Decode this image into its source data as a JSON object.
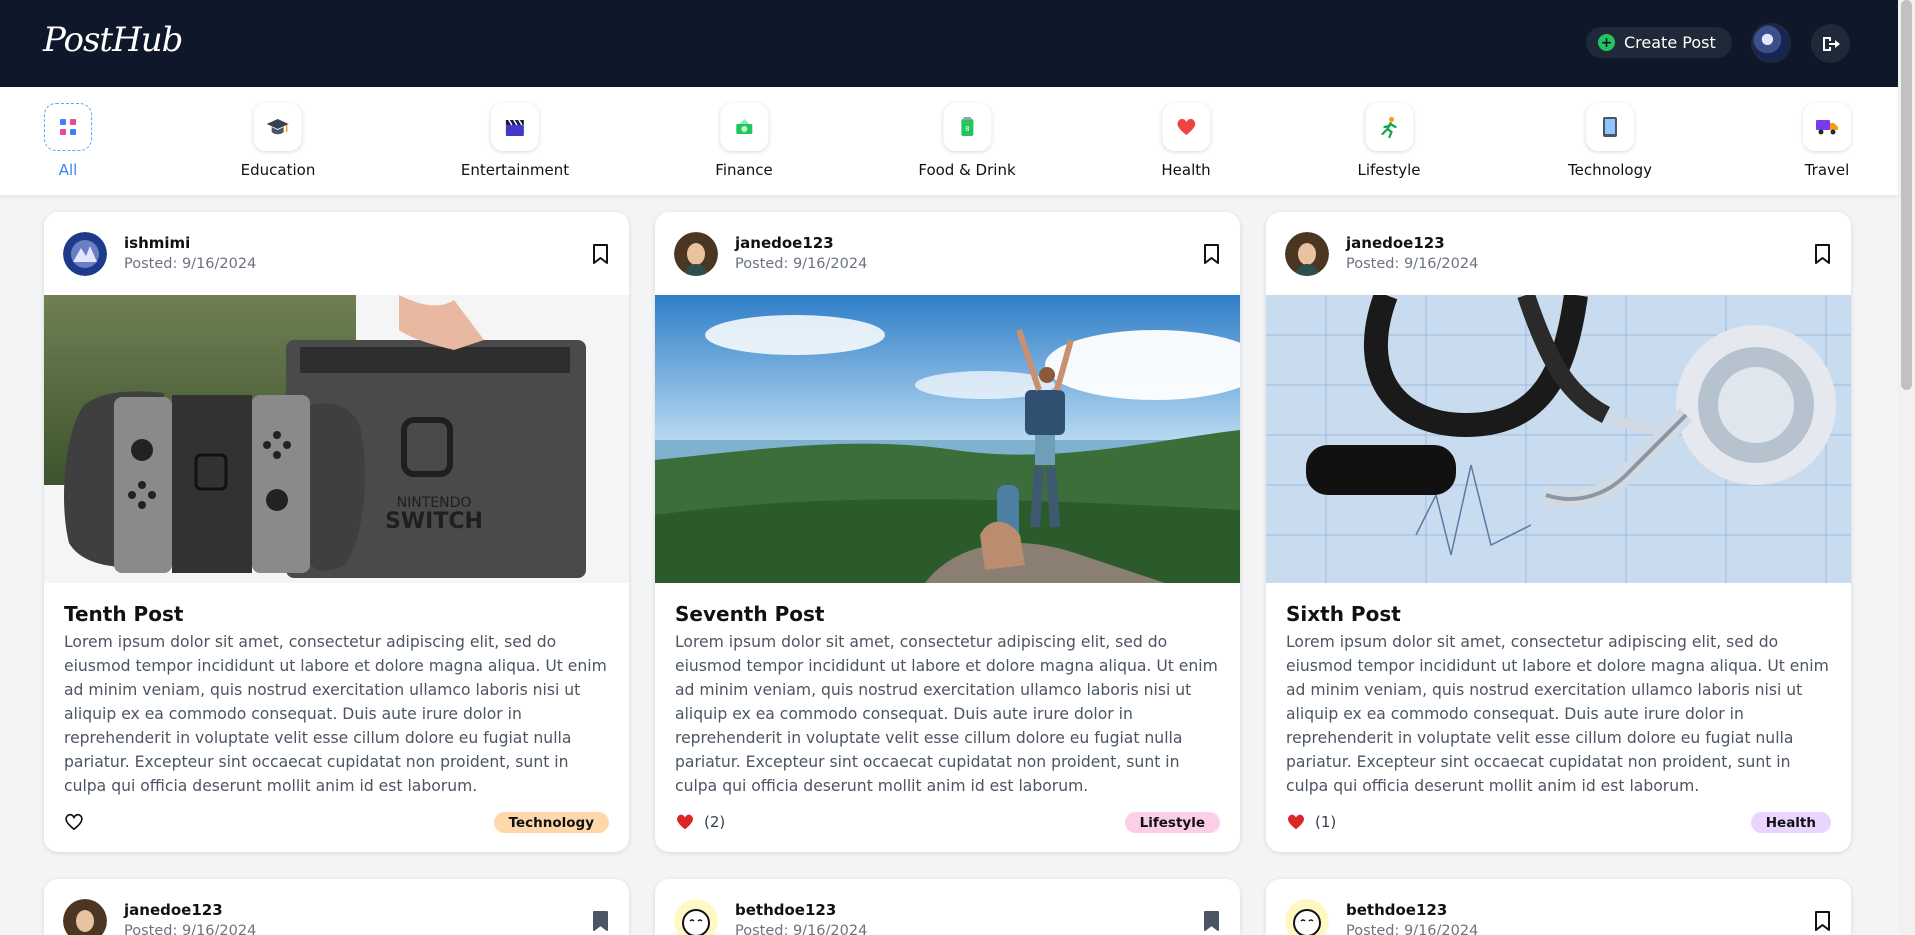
{
  "header": {
    "logo": "PostHub",
    "create_post": "Create Post",
    "plus_icon": "+"
  },
  "categories": [
    {
      "label": "All",
      "icon": "grid-icon",
      "active": true
    },
    {
      "label": "Education",
      "icon": "graduation-cap-icon"
    },
    {
      "label": "Entertainment",
      "icon": "clapperboard-icon"
    },
    {
      "label": "Finance",
      "icon": "money-icon"
    },
    {
      "label": "Food & Drink",
      "icon": "drink-can-icon"
    },
    {
      "label": "Health",
      "icon": "heart-icon"
    },
    {
      "label": "Lifestyle",
      "icon": "running-icon"
    },
    {
      "label": "Technology",
      "icon": "tablet-icon"
    },
    {
      "label": "Travel",
      "icon": "truck-icon"
    }
  ],
  "posts": [
    {
      "username": "ishmimi",
      "date": "Posted: 9/16/2024",
      "title": "Tenth Post",
      "body": "Lorem ipsum dolor sit amet, consectetur adipiscing elit, sed do eiusmod tempor incididunt ut labore et dolore magna aliqua. Ut enim ad minim veniam, quis nostrud exercitation ullamco laboris nisi ut aliquip ex ea commodo consequat. Duis aute irure dolor in reprehenderit in voluptate velit esse cillum dolore eu fugiat nulla pariatur. Excepteur sint occaecat cupidatat non proident, sunt in culpa qui officia deserunt mollit anim id est laborum.",
      "likes": "",
      "liked": false,
      "tag": "Technology",
      "tag_color": "#fed7aa",
      "image": "nintendo-switch-photo"
    },
    {
      "username": "janedoe123",
      "date": "Posted: 9/16/2024",
      "title": "Seventh Post",
      "body": "Lorem ipsum dolor sit amet, consectetur adipiscing elit, sed do eiusmod tempor incididunt ut labore et dolore magna aliqua. Ut enim ad minim veniam, quis nostrud exercitation ullamco laboris nisi ut aliquip ex ea commodo consequat. Duis aute irure dolor in reprehenderit in voluptate velit esse cillum dolore eu fugiat nulla pariatur. Excepteur sint occaecat cupidatat non proident, sunt in culpa qui officia deserunt mollit anim id est laborum.",
      "likes": "(2)",
      "liked": true,
      "tag": "Lifestyle",
      "tag_color": "#fbcfe8",
      "image": "hikers-mountain-photo"
    },
    {
      "username": "janedoe123",
      "date": "Posted: 9/16/2024",
      "title": "Sixth Post",
      "body": "Lorem ipsum dolor sit amet, consectetur adipiscing elit, sed do eiusmod tempor incididunt ut labore et dolore magna aliqua. Ut enim ad minim veniam, quis nostrud exercitation ullamco laboris nisi ut aliquip ex ea commodo consequat. Duis aute irure dolor in reprehenderit in voluptate velit esse cillum dolore eu fugiat nulla pariatur. Excepteur sint occaecat cupidatat non proident, sunt in culpa qui officia deserunt mollit anim id est laborum.",
      "likes": "(1)",
      "liked": true,
      "tag": "Health",
      "tag_color": "#e9d5ff",
      "image": "stethoscope-photo"
    }
  ],
  "posts_partial": [
    {
      "username": "janedoe123",
      "date": "Posted: 9/16/2024",
      "bookmarked": true
    },
    {
      "username": "bethdoe123",
      "date": "Posted: 9/16/2024",
      "bookmarked": true
    },
    {
      "username": "bethdoe123",
      "date": "Posted: 9/16/2024",
      "bookmarked": false
    }
  ]
}
